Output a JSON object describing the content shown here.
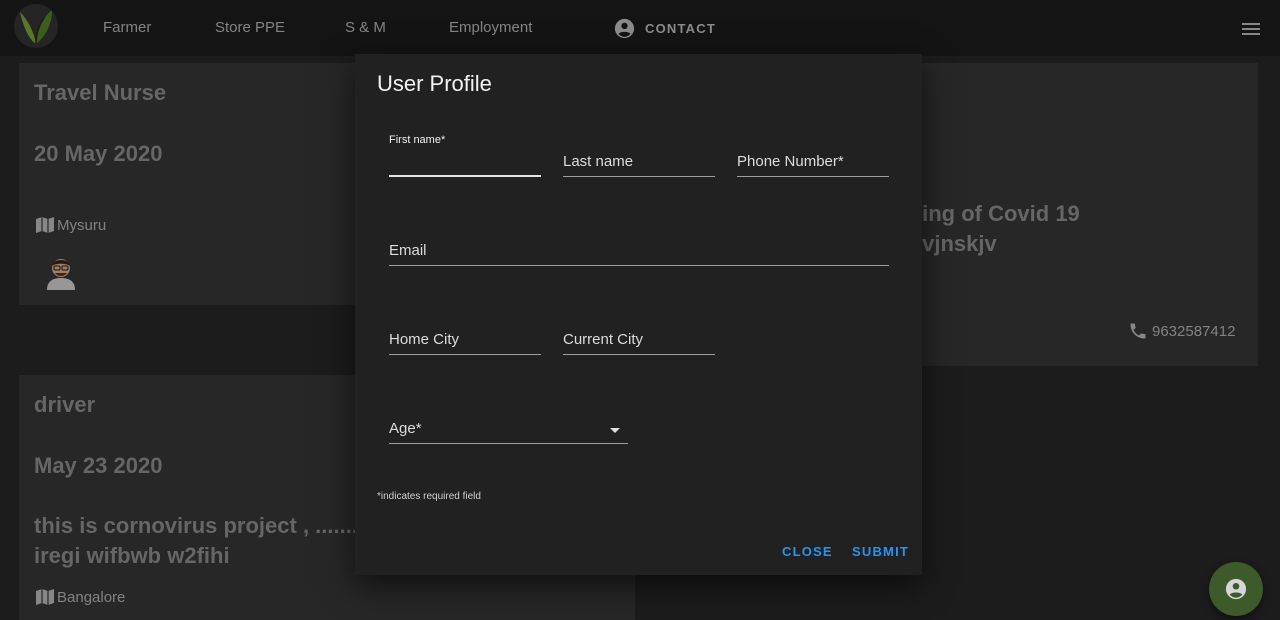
{
  "nav": {
    "items": [
      {
        "label": "Farmer"
      },
      {
        "label": "Store PPE"
      },
      {
        "label": "S & M"
      },
      {
        "label": "Employment"
      }
    ],
    "contact_label": "CONTACT"
  },
  "cards": {
    "travel_nurse": {
      "title": "Travel Nurse",
      "date": "20 May 2020",
      "location": "Mysuru"
    },
    "covid": {
      "line1": "ling of Covid 19",
      "line2": "jvjnskjv",
      "phone": "9632587412"
    },
    "driver": {
      "title": "driver",
      "date": "May 23 2020",
      "line1": "this is cornovirus project , ........",
      "line2": "iregi wifbwb w2fihi",
      "location": "Bangalore"
    }
  },
  "dialog": {
    "title": "User Profile",
    "fields": {
      "first_name": {
        "label": "First name*",
        "value": ""
      },
      "last_name": {
        "label": "Last name"
      },
      "phone": {
        "label": "Phone Number*"
      },
      "email": {
        "label": "Email"
      },
      "home_city": {
        "label": "Home City"
      },
      "current_city": {
        "label": "Current City"
      },
      "age": {
        "label": "Age*"
      }
    },
    "note": "*indicates required field",
    "close_label": "CLOSE",
    "submit_label": "SUBMIT"
  },
  "colors": {
    "accent": "#2196f3",
    "fab": "#3c5a2a"
  },
  "icons": {
    "logo": "leaf-logo-icon",
    "contact": "account-circle-icon",
    "menu": "hamburger-menu-icon",
    "location": "map-icon",
    "phone": "phone-icon",
    "fab": "account-circle-icon"
  }
}
